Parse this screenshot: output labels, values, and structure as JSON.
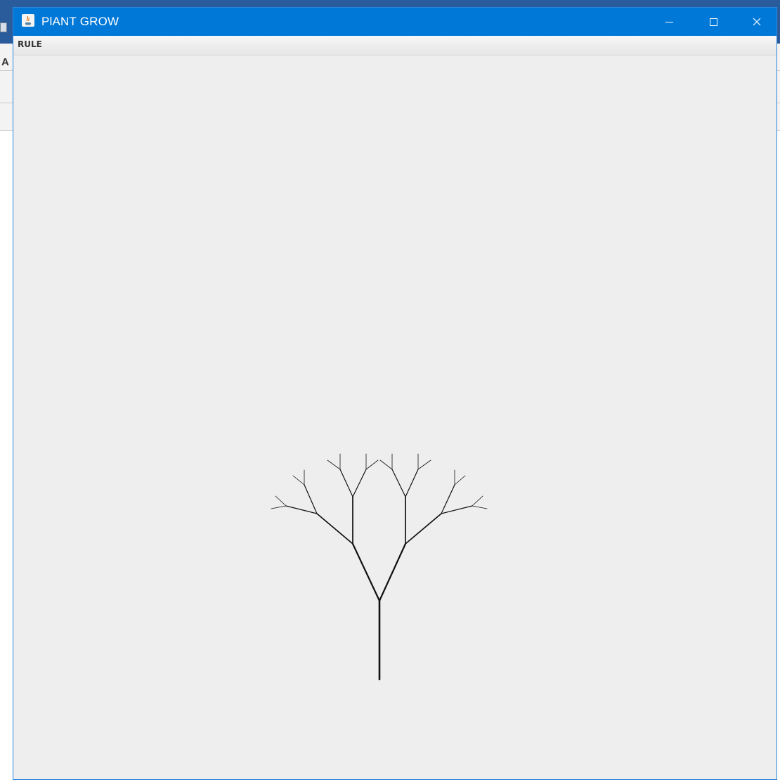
{
  "window": {
    "title": "PlANT GROW",
    "menu": [
      {
        "label": "RULE"
      }
    ],
    "controls": {
      "minimize": "minimize-icon",
      "maximize": "maximize-icon",
      "close": "close-icon"
    }
  },
  "background_app": {
    "visible_letter": "A"
  },
  "colors": {
    "titlebar": "#0078d7",
    "canvas": "#eeeeee",
    "branch": "#111111"
  }
}
